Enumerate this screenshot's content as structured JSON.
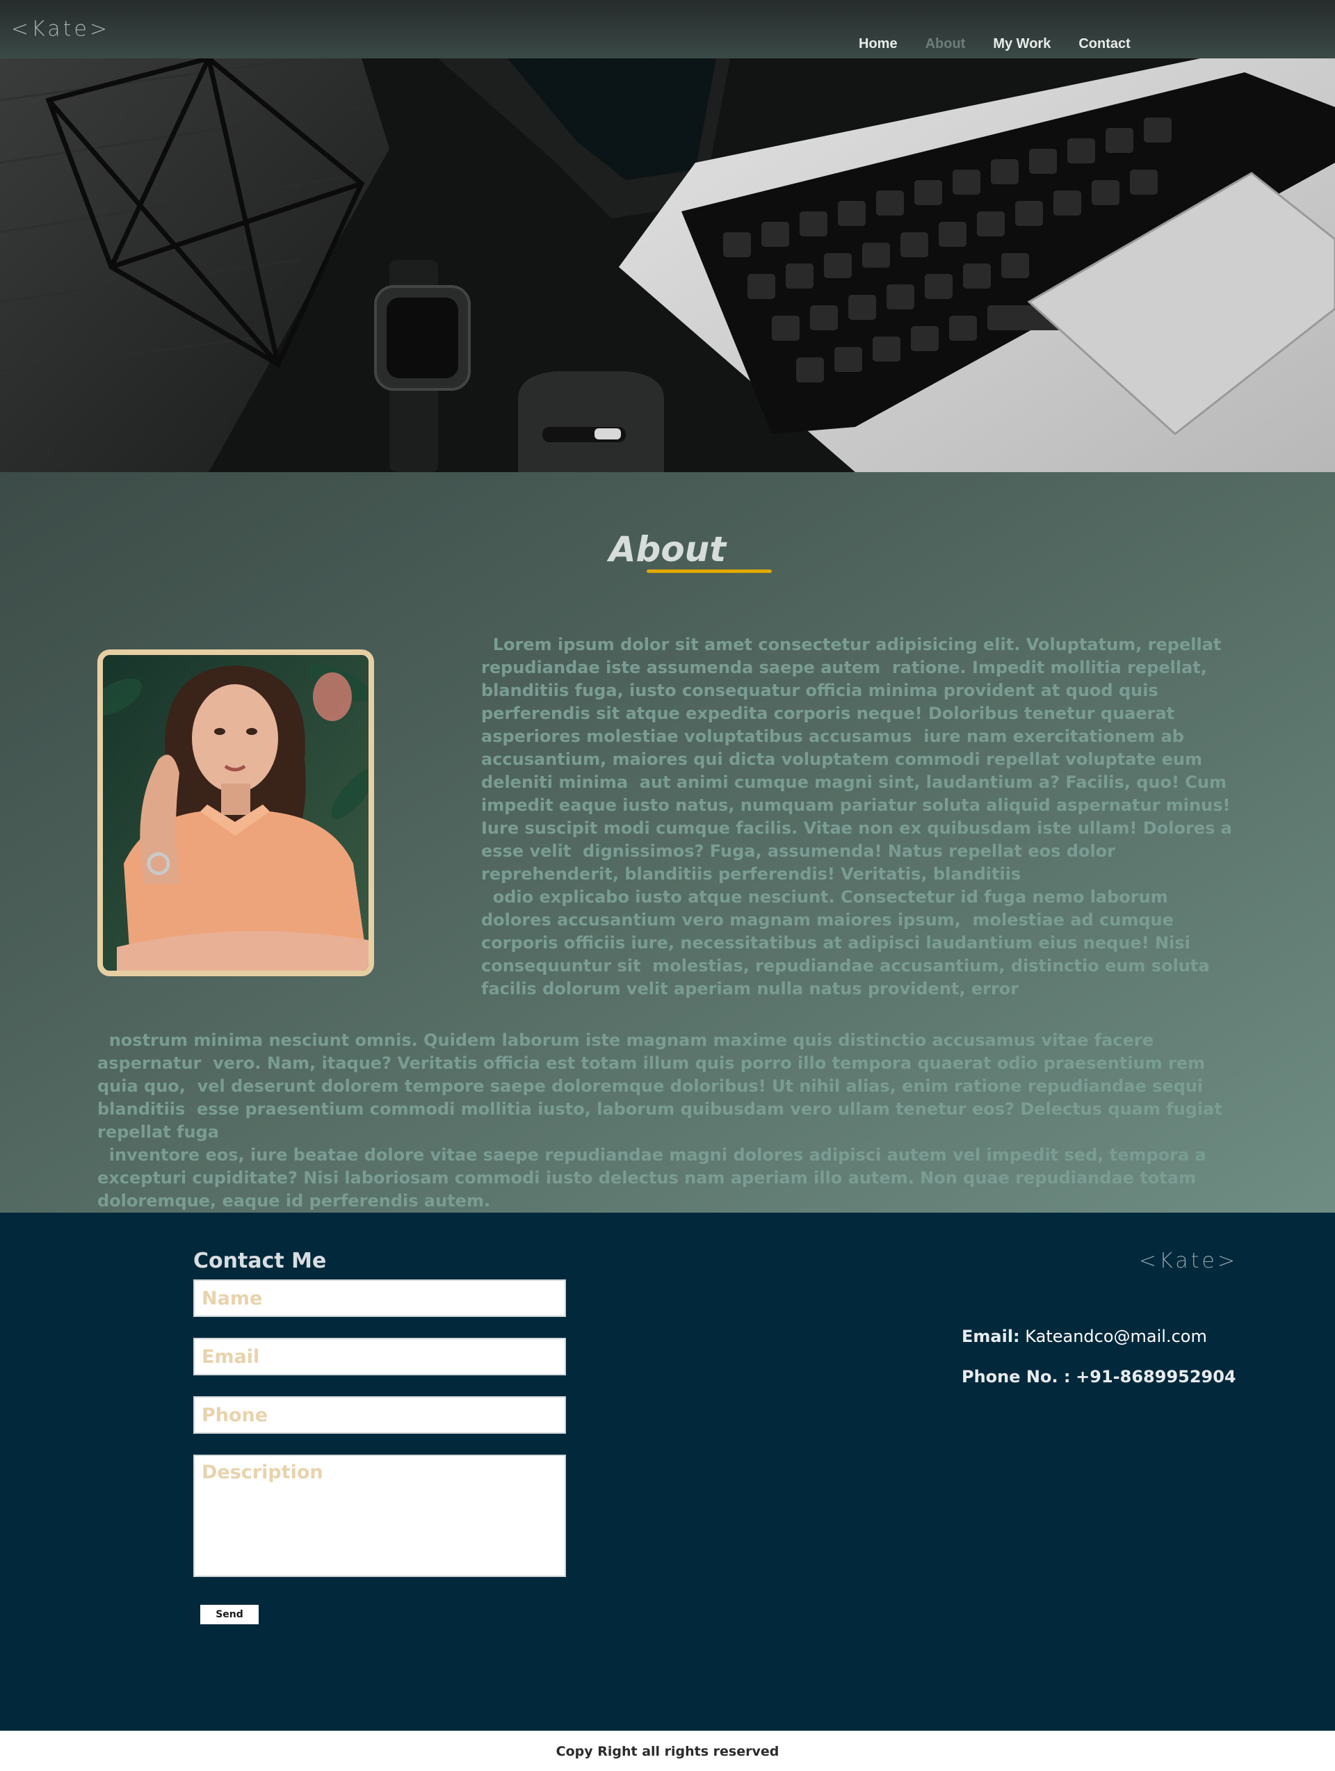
{
  "navbar": {
    "logo": "<Kate>",
    "links": [
      {
        "label": "Home",
        "active": false
      },
      {
        "label": "About",
        "active": true
      },
      {
        "label": "My Work",
        "active": false
      },
      {
        "label": "Contact",
        "active": false
      }
    ]
  },
  "about": {
    "title": "About",
    "paragraph_1": "  Lorem ipsum dolor sit amet consectetur adipisicing elit. Voluptatum, repellat repudiandae iste assumenda saepe autem  ratione. Impedit mollitia repellat, blanditiis fuga, iusto consequatur officia minima provident at quod quis  perferendis sit atque expedita corporis neque! Doloribus tenetur quaerat asperiores molestiae voluptatibus accusamus  iure nam exercitationem ab accusantium, maiores qui dicta voluptatem commodi repellat voluptate eum deleniti minima  aut animi cumque magni sint, laudantium a? Facilis, quo! Cum impedit eaque iusto natus, numquam pariatur soluta aliquid aspernatur minus! Iure suscipit modi cumque facilis. Vitae non ex quibusdam iste ullam! Dolores a esse velit  dignissimos? Fuga, assumenda! Natus repellat eos dolor reprehenderit, blanditiis perferendis! Veritatis, blanditiis\n  odio explicabo iusto atque nesciunt. Consectetur id fuga nemo laborum dolores accusantium vero magnam maiores ipsum,  molestiae ad cumque corporis officiis iure, necessitatibus at adipisci laudantium eius neque! Nisi consequuntur sit  molestias, repudiandae accusantium, distinctio eum soluta facilis dolorum velit aperiam nulla natus provident, error",
    "paragraph_2": "  nostrum minima nesciunt omnis. Quidem laborum iste magnam maxime quis distinctio accusamus vitae facere aspernatur  vero. Nam, itaque? Veritatis officia est totam illum quis porro illo tempora quaerat odio praesentium rem quia quo,  vel deserunt dolorem tempore saepe doloremque doloribus! Ut nihil alias, enim ratione repudiandae sequi blanditiis  esse praesentium commodi mollitia iusto, laborum quibusdam vero ullam tenetur eos? Delectus quam fugiat repellat fuga\n  inventore eos, iure beatae dolore vitae saepe repudiandae magni dolores adipisci autem vel impedit sed, tempora a  excepturi cupiditate? Nisi laboriosam commodi iusto delectus nam aperiam illo autem. Non quae repudiandae totam  doloremque, eaque id perferendis autem."
  },
  "contact": {
    "title": "Contact Me",
    "name_placeholder": "Name",
    "email_placeholder": "Email",
    "phone_placeholder": "Phone",
    "description_placeholder": "Description",
    "send_label": "Send",
    "footer_logo": "<Kate>",
    "email_label": "Email:",
    "email_value": "Kateandco@mail.com",
    "phone_label": "Phone No. :",
    "phone_value": "+91-8689952904"
  },
  "copyright": "Copy Right all rights reserved",
  "colors": {
    "accent": "#e0a800",
    "contact_bg": "#01283b",
    "frame": "#e7cfa4",
    "placeholder": "#e8d3ad"
  },
  "images": {
    "hero": "desk-with-laptop-watch-mouse",
    "profile": "woman-in-orange-shirt-portrait"
  }
}
